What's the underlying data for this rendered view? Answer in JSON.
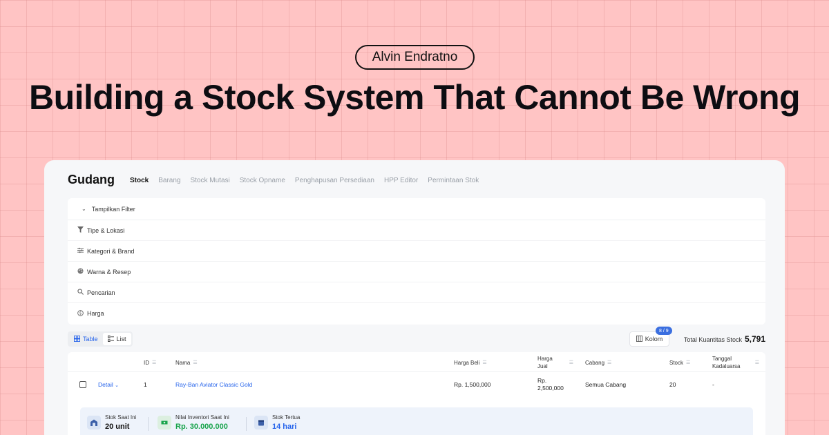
{
  "author": "Alvin Endratno",
  "headline": "Building a Stock System That Cannot Be Wrong",
  "app": {
    "brand": "Gudang",
    "nav": [
      "Stock",
      "Barang",
      "Stock Mutasi",
      "Stock Opname",
      "Penghapusan Persediaan",
      "HPP Editor",
      "Permintaan Stok"
    ],
    "active_nav": "Stock"
  },
  "filters": {
    "toggle_label": "Tampilkan Filter",
    "rows": [
      {
        "label": "Tipe & Lokasi",
        "icon": "filter-icon"
      },
      {
        "label": "Kategori & Brand",
        "icon": "sliders-icon"
      },
      {
        "label": "Warna & Resep",
        "icon": "palette-icon"
      },
      {
        "label": "Pencarian",
        "icon": "search-icon"
      },
      {
        "label": "Harga",
        "icon": "dollar-icon"
      }
    ]
  },
  "view": {
    "table_label": "Table",
    "list_label": "List"
  },
  "kolom": {
    "label": "Kolom",
    "badge": "8 / 9"
  },
  "total": {
    "label": "Total Kuantitas Stock",
    "value": "5,791"
  },
  "table": {
    "headers": {
      "id": "ID",
      "nama": "Nama",
      "harga_beli": "Harga Beli",
      "harga_jual": "Harga Jual",
      "cabang": "Cabang",
      "stock": "Stock",
      "tanggal": "Tanggal Kadaluarsa"
    },
    "rows": [
      {
        "detail": "Detail",
        "id": "1",
        "nama": "Ray-Ban Aviator Classic Gold",
        "harga_beli": "Rp. 1,500,000",
        "harga_jual": "Rp. 2,500,000",
        "cabang": "Semua Cabang",
        "stock": "20",
        "tanggal": "-"
      }
    ]
  },
  "detail_stats": [
    {
      "label": "Stok Saat Ini",
      "value": "20 unit",
      "icon": "warehouse-icon"
    },
    {
      "label": "Nilai Inventori Saat Ini",
      "value": "Rp. 30.000.000",
      "icon": "cash-icon"
    },
    {
      "label": "Stok Tertua",
      "value": "14 hari",
      "icon": "calendar-icon"
    }
  ]
}
